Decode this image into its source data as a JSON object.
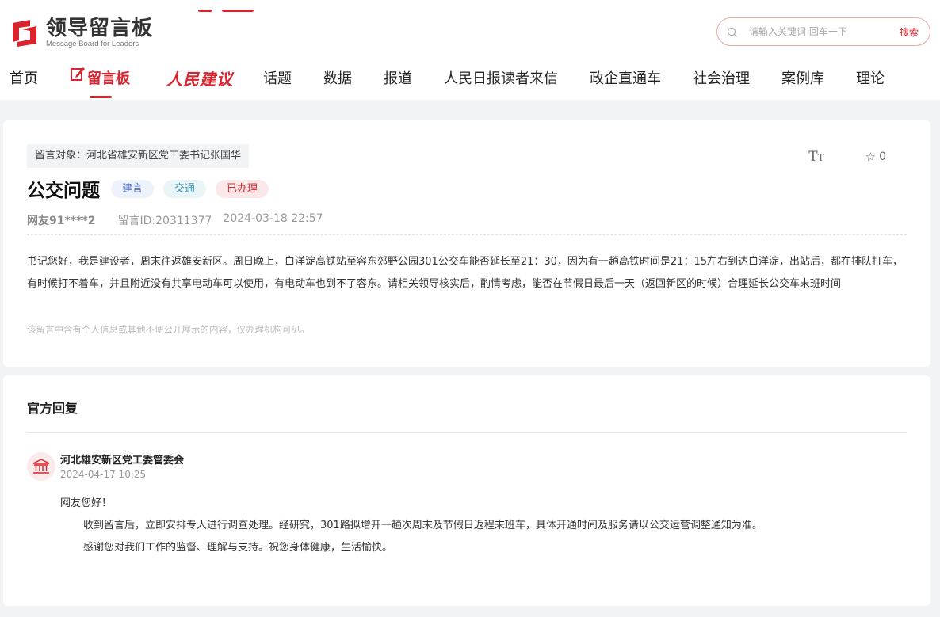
{
  "site": {
    "logo_cn": "领导留言板",
    "logo_en": "Message Board for Leaders"
  },
  "search": {
    "placeholder": "请输入关键词 回车一下",
    "button": "搜索"
  },
  "nav": {
    "items": [
      {
        "label": "首页"
      },
      {
        "label": "留言板"
      },
      {
        "label": "人民建议"
      },
      {
        "label": "话题"
      },
      {
        "label": "数据"
      },
      {
        "label": "报道"
      },
      {
        "label": "人民日报读者来信"
      },
      {
        "label": "政企直通车"
      },
      {
        "label": "社会治理"
      },
      {
        "label": "案例库"
      },
      {
        "label": "理论"
      }
    ],
    "active_index": 1
  },
  "message": {
    "target": "留言对象：河北省雄安新区党工委书记张国华",
    "title": "公交问题",
    "tags": [
      "建言",
      "交通",
      "已办理"
    ],
    "favorite_count": "0",
    "font_icon": "Tт",
    "user": "网友91****2",
    "message_id": "留言ID:20311377",
    "datetime": "2024-03-18 22:57",
    "content": "书记您好，我是建设者，周末往返雄安新区。周日晚上，白洋淀高铁站至容东郊野公园301公交车能否延长至21：30，因为有一趟高铁时间是21：15左右到达白洋淀，出站后，都在排队打车，有时候打不着车，并且附近没有共享电动车可以使用，有电动车也到不了容东。请相关领导核实后，酌情考虑，能否在节假日最后一天（返回新区的时候）合理延长公交车末班时间",
    "privacy_notice": "该留言中含有个人信息或其他不便公开展示的内容，仅办理机构可见。"
  },
  "reply": {
    "section_title": "官方回复",
    "org_name": "河北雄安新区党工委管委会",
    "datetime": "2024-04-17 10:25",
    "greeting": "网友您好！",
    "paragraph1": "收到留言后，立即安排专人进行调查处理。经研究，301路拟增开一趟次周末及节假日返程末班车，具体开通时间及服务请以公交运营调整通知为准。",
    "paragraph2": "感谢您对我们工作的监督、理解与支持。祝您身体健康，生活愉快。"
  },
  "icons": {
    "search": "search-icon",
    "star": "star-icon",
    "font_size": "font-size-icon",
    "org": "government-building-icon",
    "pen": "pen-edit-icon"
  },
  "colors": {
    "brand_red": "#d9232d",
    "background": "#f2f3f5"
  }
}
